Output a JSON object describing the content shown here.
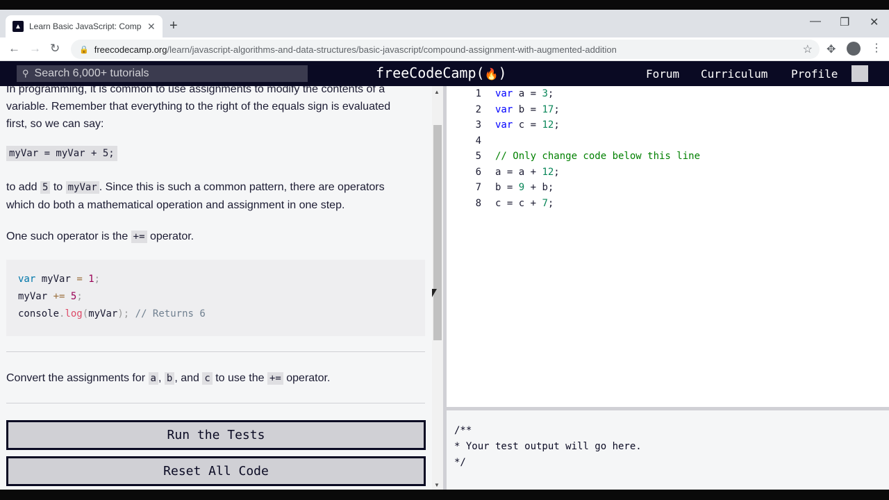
{
  "browser": {
    "tab_title": "Learn Basic JavaScript: Compoun",
    "url_host": "freecodecamp.org",
    "url_path": "/learn/javascript-algorithms-and-data-structures/basic-javascript/compound-assignment-with-augmented-addition"
  },
  "fcc": {
    "search_placeholder": "Search 6,000+ tutorials",
    "logo": "freeCodeCamp(🔥)",
    "nav": [
      "Forum",
      "Curriculum",
      "Profile"
    ]
  },
  "lesson": {
    "p1_line1": "In programming, it is common to use assignments to modify the contents of a",
    "p1_line2": "variable. Remember that everything to the right of the equals sign is evaluated",
    "p1_line3": "first, so we can say:",
    "example_inline": "myVar = myVar + 5;",
    "p2_a": "to add ",
    "p2_code1": "5",
    "p2_b": " to ",
    "p2_code2": "myVar",
    "p2_c": ". Since this is such a common pattern, there are operators",
    "p2_line2": "which do both a mathematical operation and assignment in one step.",
    "p3_a": "One such operator is the ",
    "p3_code": "+=",
    "p3_b": " operator.",
    "code_lines": [
      "var myVar = 1;",
      "myVar += 5;",
      "console.log(myVar); // Returns 6"
    ],
    "task_a": "Convert the assignments for ",
    "task_c1": "a",
    "task_sep1": ", ",
    "task_c2": "b",
    "task_sep2": ", and ",
    "task_c3": "c",
    "task_b": " to use the ",
    "task_c4": "+=",
    "task_end": " operator."
  },
  "buttons": {
    "run": "Run the Tests",
    "reset": "Reset All Code"
  },
  "editor": {
    "lines": [
      {
        "n": "1",
        "kw": "var",
        "rest": " a = ",
        "num": "3",
        "end": ";"
      },
      {
        "n": "2",
        "kw": "var",
        "rest": " b = ",
        "num": "17",
        "end": ";"
      },
      {
        "n": "3",
        "kw": "var",
        "rest": " c = ",
        "num": "12",
        "end": ";"
      },
      {
        "n": "4",
        "kw": "",
        "rest": "",
        "num": "",
        "end": ""
      },
      {
        "n": "5",
        "comment": "// Only change code below this line"
      },
      {
        "n": "6",
        "kw": "",
        "rest": "a = a + ",
        "num": "12",
        "end": ";"
      },
      {
        "n": "7",
        "kw": "",
        "rest": "b = ",
        "num": "9",
        "end": " + b;"
      },
      {
        "n": "8",
        "kw": "",
        "rest": "c = c + ",
        "num": "7",
        "end": ";"
      }
    ]
  },
  "output": {
    "text": "/**\n* Your test output will go here.\n*/"
  }
}
